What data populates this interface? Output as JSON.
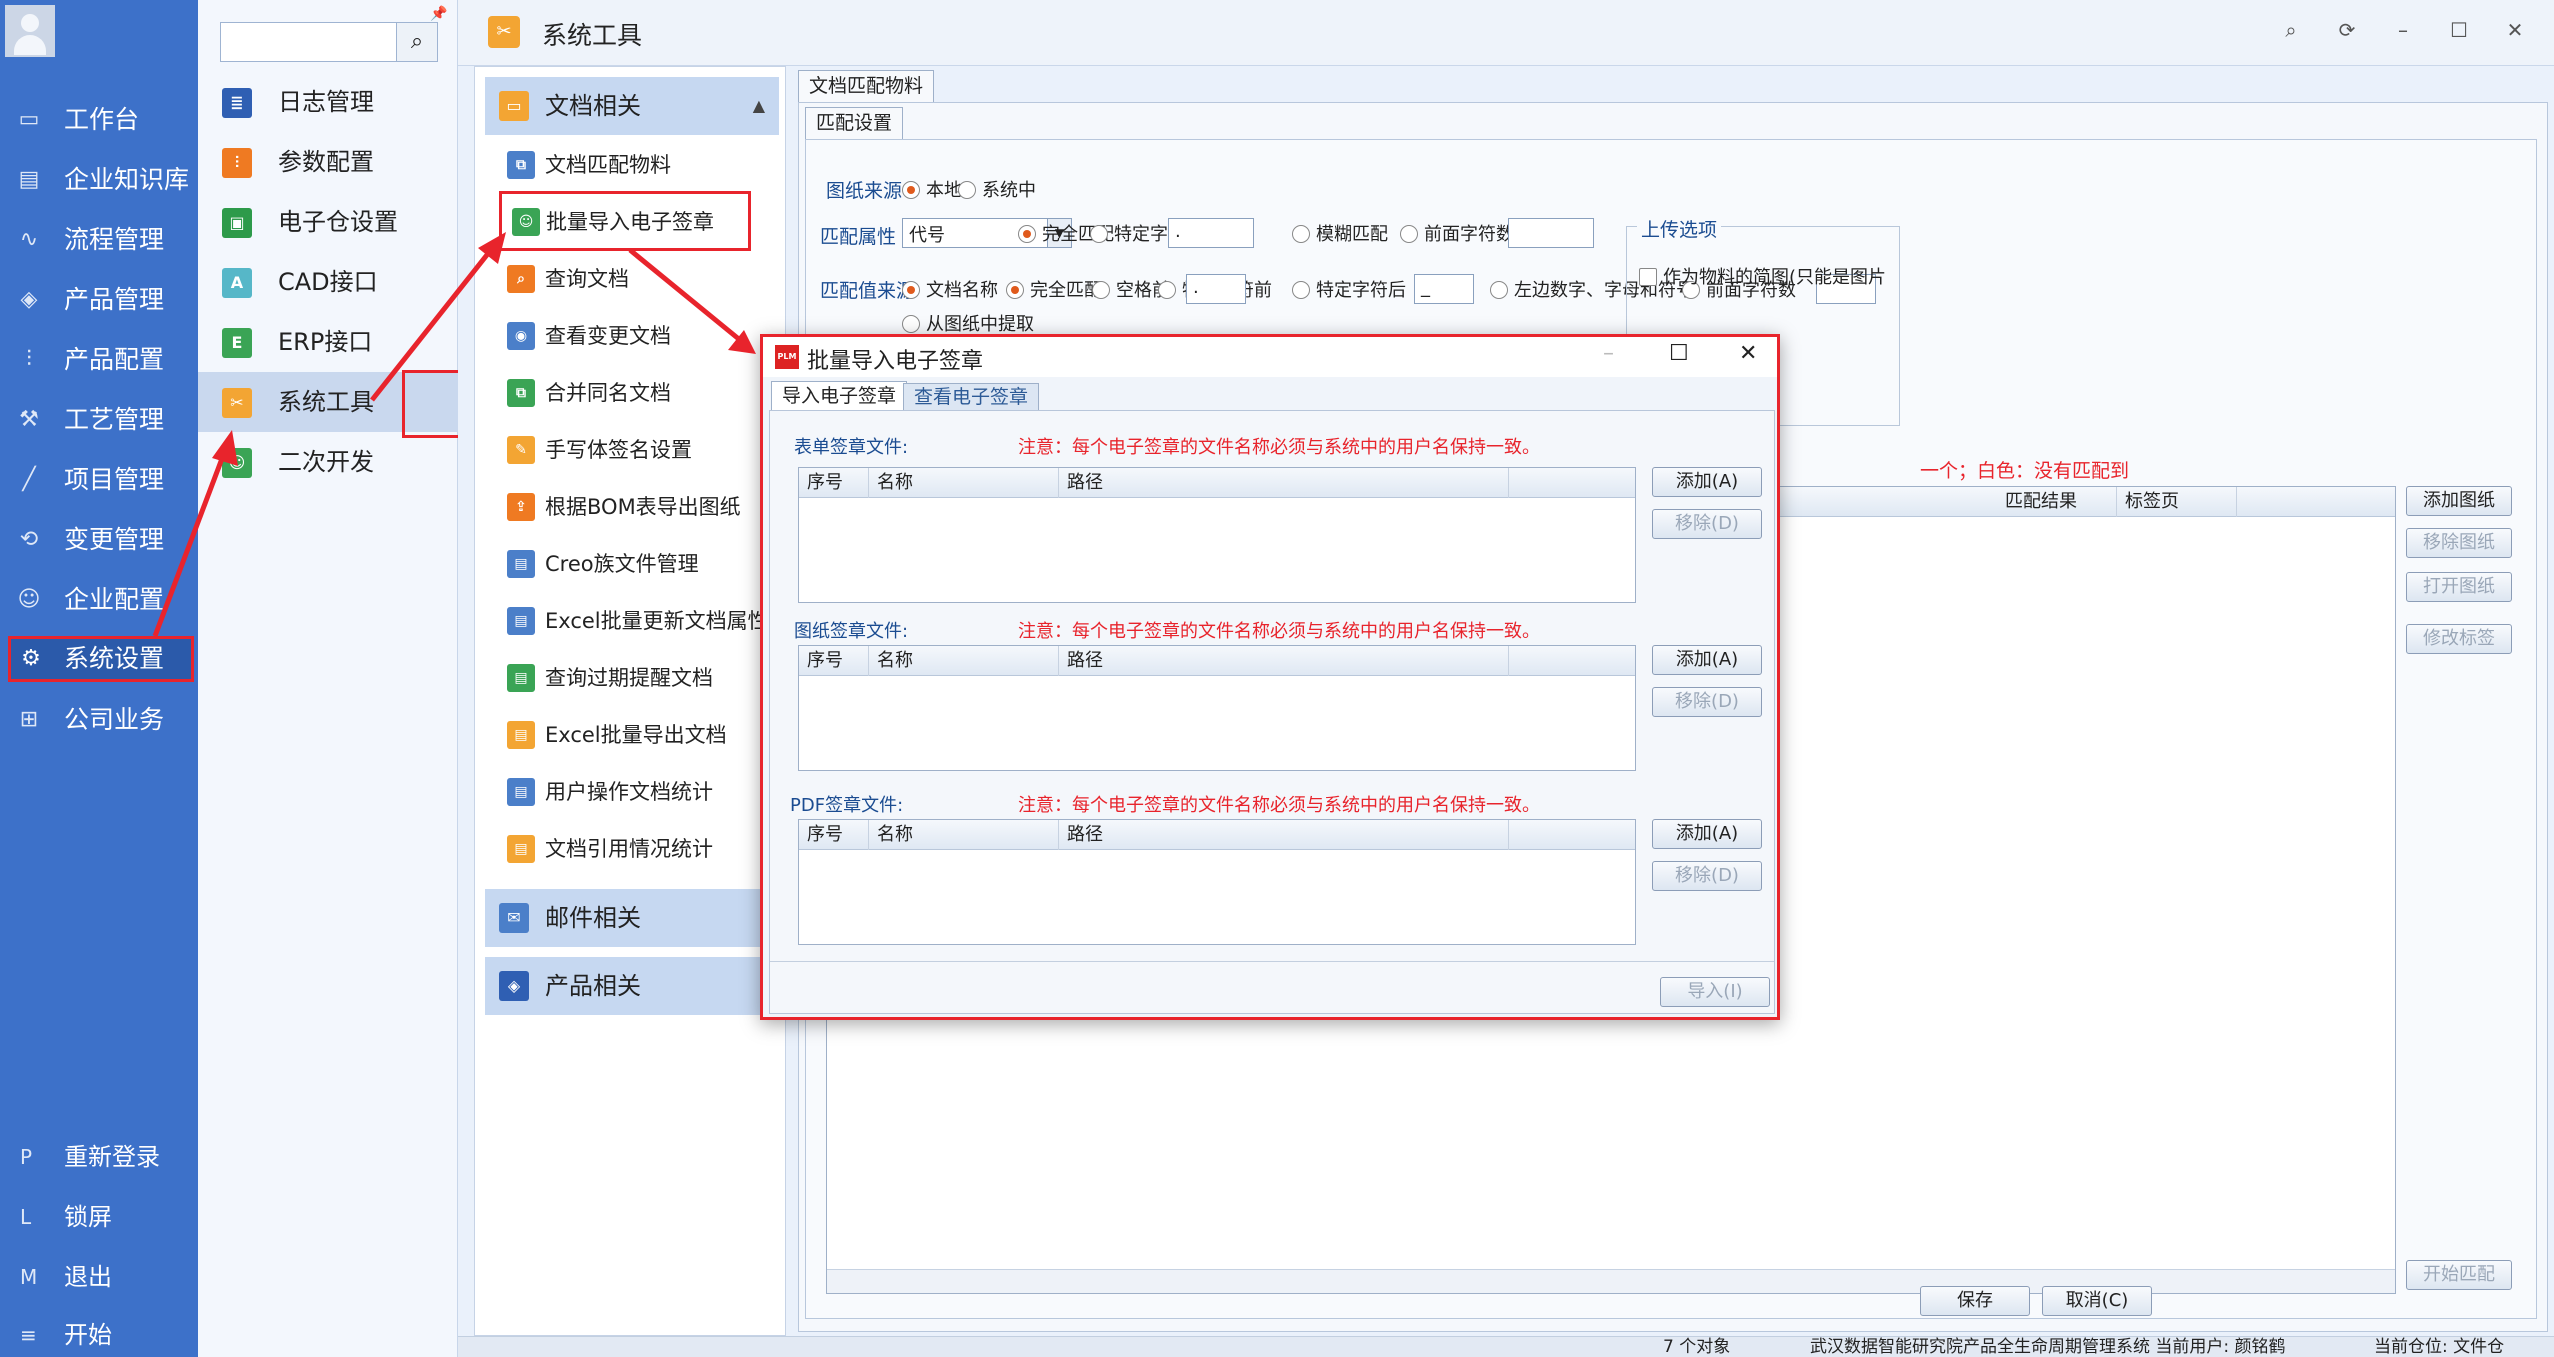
{
  "nav": {
    "items": [
      {
        "label": "工作台",
        "icon": "monitor-icon"
      },
      {
        "label": "企业知识库",
        "icon": "book-icon"
      },
      {
        "label": "流程管理",
        "icon": "flow-icon"
      },
      {
        "label": "产品管理",
        "icon": "box-icon"
      },
      {
        "label": "产品配置",
        "icon": "sliders-icon"
      },
      {
        "label": "工艺管理",
        "icon": "wrench-icon"
      },
      {
        "label": "项目管理",
        "icon": "chart-icon"
      },
      {
        "label": "变更管理",
        "icon": "change-icon"
      },
      {
        "label": "企业配置",
        "icon": "users-icon"
      },
      {
        "label": "系统设置",
        "icon": "gear-icon"
      },
      {
        "label": "公司业务",
        "icon": "grid-icon"
      }
    ],
    "bottom": [
      {
        "key": "P",
        "label": "重新登录"
      },
      {
        "key": "L",
        "label": "锁屏"
      },
      {
        "key": "M",
        "label": "退出"
      },
      {
        "key": "≡",
        "label": "开始"
      }
    ]
  },
  "sub": {
    "search_placeholder": "",
    "items": [
      {
        "label": "日志管理",
        "color": "#2f5fb3"
      },
      {
        "label": "参数配置",
        "color": "#ef7a22"
      },
      {
        "label": "电子仓设置",
        "color": "#2d9a4a"
      },
      {
        "label": "CAD接口",
        "color": "#56b7c8"
      },
      {
        "label": "ERP接口",
        "color": "#3aa455"
      },
      {
        "label": "系统工具",
        "color": "#f3a533"
      },
      {
        "label": "二次开发",
        "color": "#3aa455"
      }
    ]
  },
  "titlebar": {
    "title": "系统工具"
  },
  "side2": {
    "group1": "文档相关",
    "items": [
      {
        "label": "文档匹配物料",
        "color": "#4b7fc9"
      },
      {
        "label": "批量导入电子签章",
        "color": "#3aa455"
      },
      {
        "label": "查询文档",
        "color": "#ef7a22"
      },
      {
        "label": "查看变更文档",
        "color": "#4b7fc9"
      },
      {
        "label": "合并同名文档",
        "color": "#3aa455"
      },
      {
        "label": "手写体签名设置",
        "color": "#f3a533"
      },
      {
        "label": "根据BOM表导出图纸",
        "color": "#ef7a22"
      },
      {
        "label": "Creo族文件管理",
        "color": "#4b7fc9"
      },
      {
        "label": "Excel批量更新文档属性",
        "color": "#4b7fc9"
      },
      {
        "label": "查询过期提醒文档",
        "color": "#3aa455"
      },
      {
        "label": "Excel批量导出文档",
        "color": "#f3a533"
      },
      {
        "label": "用户操作文档统计",
        "color": "#4b7fc9"
      },
      {
        "label": "文档引用情况统计",
        "color": "#f3a533"
      }
    ],
    "group2": "邮件相关",
    "group3": "产品相关"
  },
  "content": {
    "tab_main": "文档匹配物料",
    "tab_sub": "匹配设置",
    "source_label": "图纸来源",
    "source_opts": [
      "本地",
      "系统中"
    ],
    "attr_label": "匹配属性",
    "attr_value": "代号",
    "attr_opts": [
      "完全匹配",
      "特定字符前",
      "模糊匹配",
      "前面字符数"
    ],
    "attr_char": ".",
    "val_label": "匹配值来源",
    "val_opts": [
      "文档名称",
      "完全匹配",
      "空格前",
      "特定字符前",
      "特定字符后",
      "左边数字、字母和符号",
      "前面字符数"
    ],
    "val_char1": ".",
    "val_char2": "_",
    "from_drawing": "从图纸中提取",
    "upload_title": "上传选项",
    "upload_check": "作为物料的简图(只能是图片",
    "legend_tail": "一个；白色：没有匹配到",
    "col_result": "匹配结果",
    "col_page": "标签页",
    "btn_add": "添加图纸",
    "btn_remove": "移除图纸",
    "btn_open": "打开图纸",
    "btn_edit": "修改标签",
    "btn_start": "开始匹配",
    "btn_save": "保存",
    "btn_cancel": "取消(C)"
  },
  "status": {
    "count": "7 个对象",
    "info": "武汉数据智能研究院产品全生命周期管理系统 当前用户: 颜铭鹤",
    "loc": "当前仓位: 文件仓"
  },
  "dialog": {
    "logo": "PLM",
    "title": "批量导入电子签章",
    "tab1": "导入电子签章",
    "tab2": "查看电子签章",
    "sections": [
      {
        "label": "表单签章文件:"
      },
      {
        "label": "图纸签章文件:"
      },
      {
        "label": "PDF签章文件:"
      }
    ],
    "note": "注意：每个电子签章的文件名称必须与系统中的用户名保持一致。",
    "cols": [
      "序号",
      "名称",
      "路径"
    ],
    "add": "添加(A)",
    "remove": "移除(D)",
    "import": "导入(I)"
  }
}
